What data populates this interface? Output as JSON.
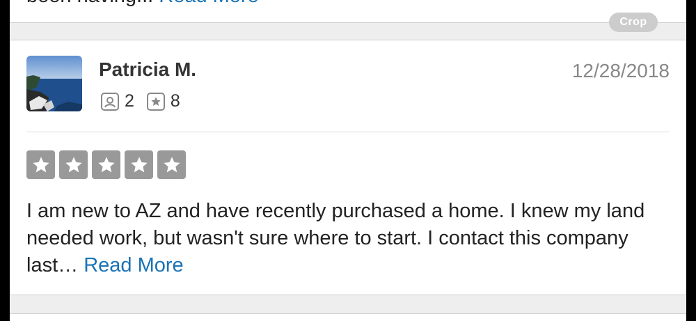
{
  "previous_review": {
    "text_fragment": "been having... ",
    "read_more": "Read More"
  },
  "crop_button": {
    "label": "Crop"
  },
  "review": {
    "user_name": "Patricia M.",
    "date": "12/28/2018",
    "friends_count": "2",
    "reviews_count": "8",
    "rating": 5,
    "rating_max": 5,
    "text": "I am new to AZ and have recently purchased a home. I knew my land needed work, but wasn't sure where to start.  I contact this company last… ",
    "read_more": "Read More"
  },
  "icons": {
    "friends": "friends-icon",
    "reviews": "star-review-icon",
    "star": "star-icon"
  },
  "colors": {
    "link": "#1a73b5",
    "star_inactive_bg": "#999999",
    "crop_bg": "#cccccc"
  }
}
